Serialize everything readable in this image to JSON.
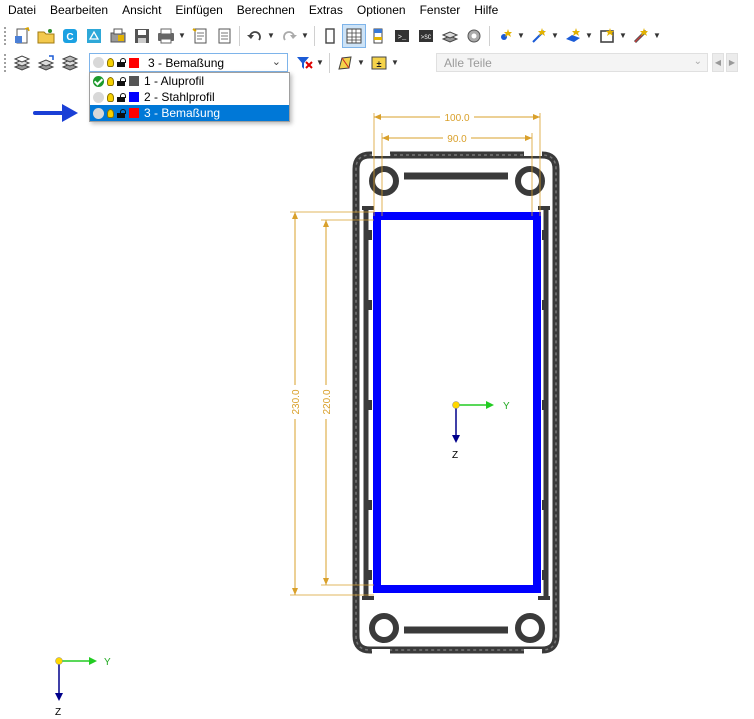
{
  "menu": [
    "Datei",
    "Bearbeiten",
    "Ansicht",
    "Einfügen",
    "Berechnen",
    "Extras",
    "Optionen",
    "Fenster",
    "Hilfe"
  ],
  "layer_select": {
    "selected": "3 - Bemaßung",
    "selected_color": "#ff0000",
    "items": [
      {
        "label": "1 - Aluprofil",
        "color": "#555555",
        "active": true
      },
      {
        "label": "2 - Stahlprofil",
        "color": "#0000ff",
        "active": false
      },
      {
        "label": "3 - Bemaßung",
        "color": "#ff0000",
        "active": false,
        "highlighted": true
      }
    ]
  },
  "parts_filter": {
    "placeholder": "Alle Teile"
  },
  "dimensions": {
    "outer_width": "100.0",
    "inner_width": "90.0",
    "outer_height": "230.0",
    "inner_height": "220.0"
  },
  "axes": {
    "y_label": "Y",
    "z_label": "Z"
  },
  "colors": {
    "dimension": "#d9a02b",
    "steel_profile": "#0000ff",
    "alu_profile": "#3a3a3a",
    "y_axis": "#22cc22",
    "z_axis": "#00008b",
    "origin": "#ffd700",
    "pointer_arrow": "#1a3fd6"
  }
}
